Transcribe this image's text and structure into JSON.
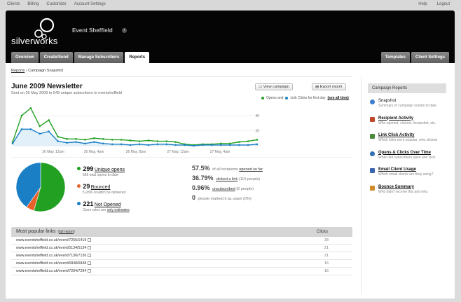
{
  "topnav": {
    "left": [
      "Clients",
      "Billing",
      "Customize",
      "Account Settings"
    ],
    "right": [
      "Help",
      "Logout"
    ]
  },
  "header": {
    "logo_text": "silverworks",
    "client_name": "Event Sheffield",
    "tabs_left": [
      "Overview",
      "Create/Send",
      "Manage Subscribers",
      "Reports"
    ],
    "active_tab": "Reports",
    "tabs_right": [
      "Templates",
      "Client Settings"
    ]
  },
  "breadcrumb": {
    "root": "Reports",
    "current": "Campaign Snapshot"
  },
  "campaign": {
    "title": "June 2009 Newsletter",
    "subtitle": "Sent on 26 May 2009 to 549 unique subscribers in eventsheffield",
    "view_button": "View campaign",
    "export_button": "Export report"
  },
  "chart_data": {
    "type": "line",
    "legend": {
      "opens": "Opens and",
      "clicks": "Link Clicks for first day",
      "see_all": "(see all time)"
    },
    "x_labels": [
      "26 May, 12pm",
      "26 May, 4pm",
      "26 May, 8pm",
      "27 May, 12am",
      "27 May, 4am"
    ],
    "y_ticks": [
      "40",
      "20"
    ],
    "ylim": [
      0,
      54
    ],
    "series": [
      {
        "name": "Opens",
        "color": "#22a022",
        "values": [
          5,
          40,
          50,
          26,
          34,
          12,
          9,
          9,
          8,
          10,
          9,
          8,
          8,
          7,
          6,
          7,
          6,
          6,
          5,
          2,
          1,
          2,
          2,
          3,
          3,
          5,
          6,
          8
        ]
      },
      {
        "name": "Link Clicks",
        "color": "#1a7fc5",
        "values": [
          3,
          22,
          22,
          16,
          19,
          6,
          4,
          5,
          3,
          5,
          3,
          2,
          2,
          1,
          2,
          1,
          2,
          2,
          1,
          1,
          0,
          1,
          1,
          1,
          1,
          1,
          1,
          2
        ]
      }
    ]
  },
  "stats": {
    "opens": {
      "count": "299",
      "label": "Unique opens",
      "sub": "559 total opens to date",
      "color": "#22a022"
    },
    "bounced": {
      "count": "29",
      "label": "Bounced",
      "sub": "5.28% couldn't be delivered",
      "color": "#e8602a"
    },
    "not_opened": {
      "count": "221",
      "label": "Not Opened",
      "sub_prefix": "Open rates are",
      "sub_link": "only estimates",
      "color": "#1a7fc5"
    }
  },
  "pie": [
    {
      "name": "Unique opens",
      "value": 299,
      "color": "#22a022"
    },
    {
      "name": "Bounced",
      "value": 29,
      "color": "#e8602a"
    },
    {
      "name": "Not Opened",
      "value": 221,
      "color": "#1a7fc5"
    }
  ],
  "rates": [
    {
      "pct": "57.5%",
      "text": "of all recipients",
      "link": "opened so far",
      "suffix": ""
    },
    {
      "pct": "36.79%",
      "text": "",
      "link": "clicked a link",
      "suffix": "(110 people)"
    },
    {
      "pct": "0.96%",
      "text": "",
      "link": "unsubscribed",
      "suffix": "(5 people)"
    },
    {
      "pct": "0",
      "text": "people marked it as spam (0%)",
      "link": "",
      "suffix": ""
    }
  ],
  "links_table": {
    "title": "Most popular links",
    "full_report": "full report",
    "col_clicks": "Clicks",
    "rows": [
      {
        "url": "www.eventsheffield.co.uk/event/7255/1419",
        "clicks": "33"
      },
      {
        "url": "www.eventsheffield.co.uk/event/5134/5134",
        "clicks": "21"
      },
      {
        "url": "www.eventsheffield.co.uk/event/7136/7136",
        "clicks": "21"
      },
      {
        "url": "www.eventsheffield.co.uk/event/6848/6848",
        "clicks": "16"
      },
      {
        "url": "www.eventsheffield.co.uk/event/7294/7294",
        "clicks": "16"
      }
    ]
  },
  "sidebar": {
    "title": "Campaign Reports",
    "items": [
      {
        "title": "Snapshot",
        "desc": "Summary of campaign results to date.",
        "icon": "pie-chart-icon",
        "color": "#3a7fd0",
        "link": false
      },
      {
        "title": "Recipient Activity",
        "desc": "Who opened, clicked, forwarded, etc.",
        "icon": "people-icon",
        "color": "#c0492b",
        "link": true
      },
      {
        "title": "Link Click Activity",
        "desc": "Which links were popular, who clicked",
        "icon": "link-icon",
        "color": "#4a8a3a",
        "link": true
      },
      {
        "title": "Opens & Clicks Over Time",
        "desc": "When did subscribers open and click",
        "icon": "clock-icon",
        "color": "#2f6fb8",
        "link": true
      },
      {
        "title": "Email Client Usage",
        "desc": "Which email clients are they using?",
        "icon": "envelope-icon",
        "color": "#3a66b0",
        "link": true
      },
      {
        "title": "Bounce Summary",
        "desc": "Who didn't receive this and why.",
        "icon": "bounce-icon",
        "color": "#d08a2a",
        "link": true
      }
    ]
  }
}
